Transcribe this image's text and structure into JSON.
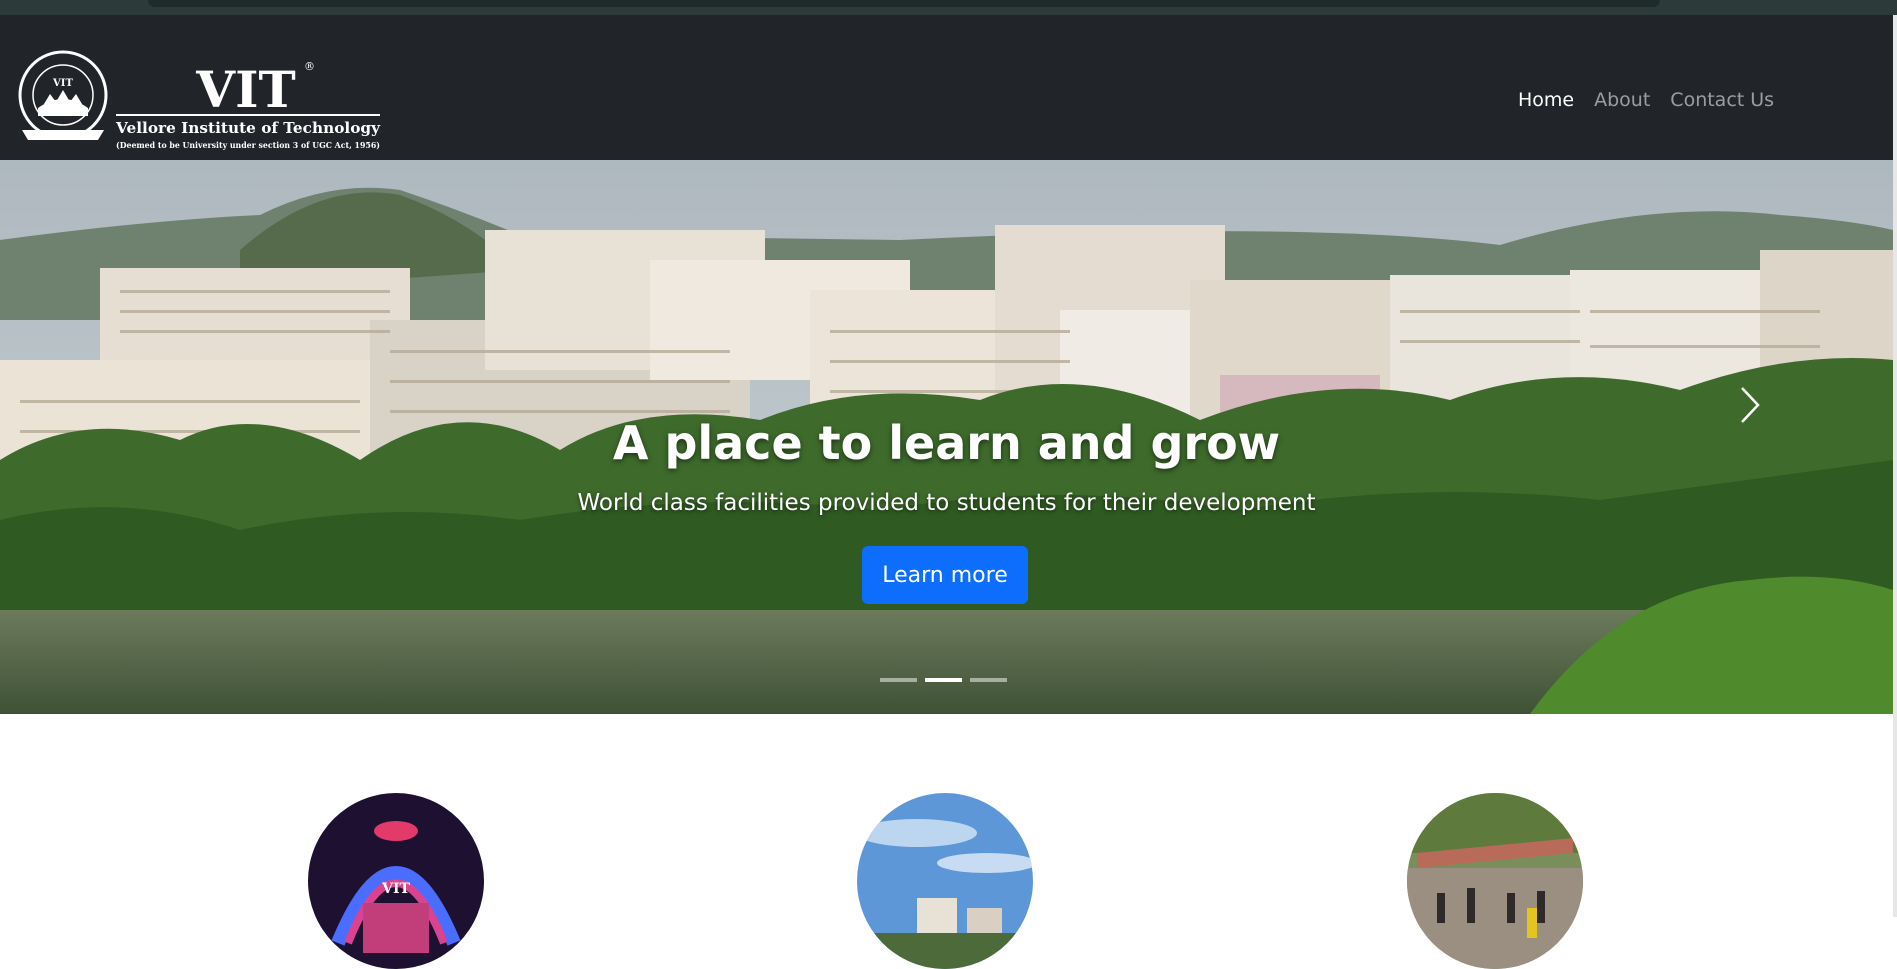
{
  "navbar": {
    "brand": {
      "seal_text": "VELLORE INSTITUTE OF TECHNOLOGY",
      "seal_center": "VIT",
      "logo_mark": "VIT",
      "registered": "®",
      "name": "Vellore Institute of Technology",
      "tagline": "(Deemed to be University under section 3 of UGC Act, 1956)"
    },
    "links": [
      {
        "label": "Home",
        "active": true
      },
      {
        "label": "About",
        "active": false
      },
      {
        "label": "Contact Us",
        "active": false
      }
    ]
  },
  "carousel": {
    "title": "A place to learn and grow",
    "subtitle": "World class facilities provided to students for their development",
    "button_label": "Learn more",
    "next_icon": "chevron-right-icon",
    "slide_count": 3,
    "active_slide": 2
  },
  "features": {
    "images": [
      "vit-event-stage-image",
      "campus-buildings-image",
      "students-campus-image"
    ]
  },
  "colors": {
    "navbar_bg": "#212529",
    "primary": "#0d6efd"
  }
}
